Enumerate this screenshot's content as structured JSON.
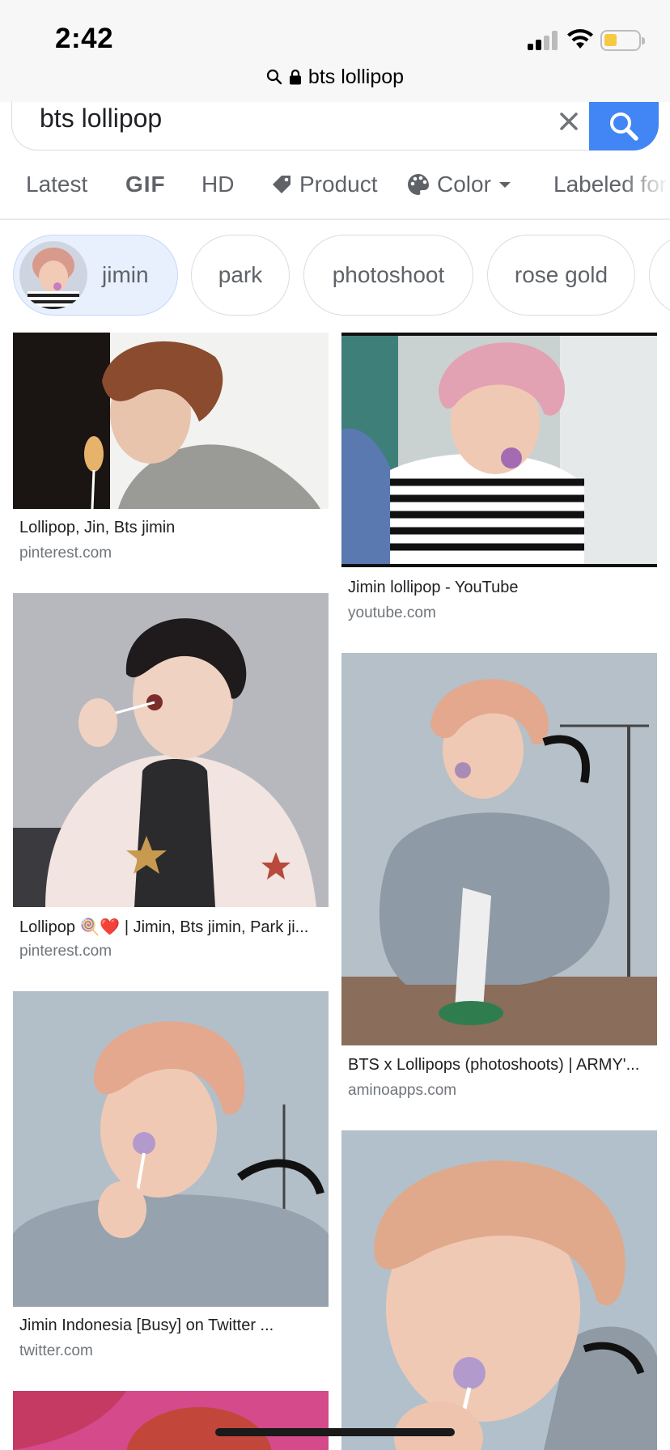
{
  "status_bar": {
    "time": "2:42",
    "url": "bts lollipop",
    "battery_color": "#f6c943"
  },
  "search": {
    "query": "bts lollipop",
    "accent_color": "#4285f4"
  },
  "filters": [
    {
      "label": "Latest",
      "icon": ""
    },
    {
      "label": "GIF",
      "icon": "gif-icon"
    },
    {
      "label": "HD",
      "icon": ""
    },
    {
      "label": "Product",
      "icon": "tag-icon"
    },
    {
      "label": "Color",
      "icon": "palette-icon"
    },
    {
      "label": "Labeled for",
      "icon": ""
    }
  ],
  "chips": [
    {
      "label": "jimin",
      "selected": true
    },
    {
      "label": "park",
      "selected": false
    },
    {
      "label": "photoshoot",
      "selected": false
    },
    {
      "label": "rose gold",
      "selected": false
    }
  ],
  "results": [
    {
      "title": "Lollipop, Jin, Bts jimin",
      "domain": "pinterest.com"
    },
    {
      "title": "Jimin lollipop - YouTube",
      "domain": "youtube.com"
    },
    {
      "title": "Lollipop 🍭❤️ | Jimin, Bts jimin, Park ji...",
      "domain": "pinterest.com"
    },
    {
      "title": "BTS x Lollipops (photoshoots) | ARMY'...",
      "domain": "aminoapps.com"
    },
    {
      "title": "Jimin Indonesia [Busy] on Twitter ...",
      "domain": "twitter.com"
    }
  ]
}
